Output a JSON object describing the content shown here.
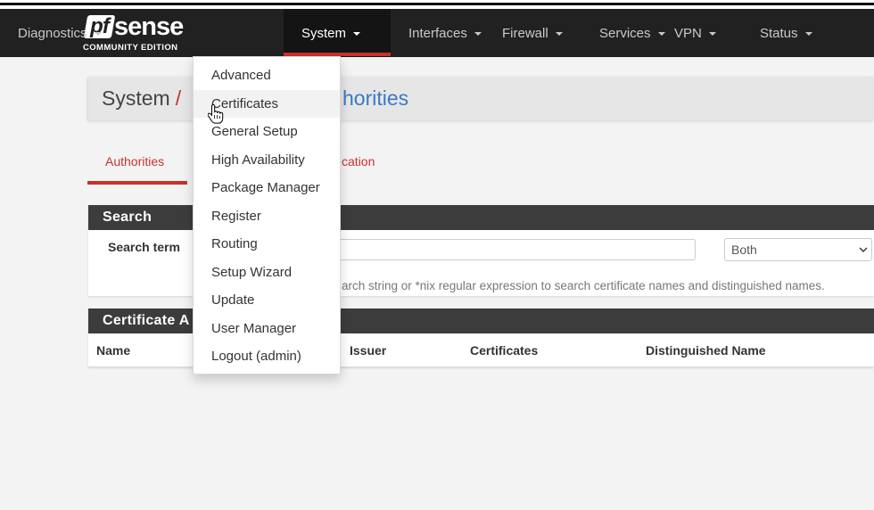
{
  "logo": {
    "mark": "pf",
    "wordmark": "sense",
    "edition": "COMMUNITY EDITION"
  },
  "navbar": {
    "items": [
      {
        "label": "System",
        "active": true,
        "icon": "caret-down-icon"
      },
      {
        "label": "Interfaces",
        "active": false,
        "icon": "caret-down-icon"
      },
      {
        "label": "Firewall",
        "active": false,
        "icon": "caret-down-icon"
      },
      {
        "label": "Services",
        "active": false,
        "icon": "caret-down-icon"
      },
      {
        "label": "VPN",
        "active": false,
        "icon": "caret-down-icon"
      },
      {
        "label": "Status",
        "active": false,
        "icon": "caret-down-icon"
      },
      {
        "label": "Diagnostics",
        "active": false,
        "icon": "caret-down-icon"
      }
    ]
  },
  "system_menu": {
    "open": true,
    "hovered_index": 1,
    "items": [
      "Advanced",
      "Certificates",
      "General Setup",
      "High Availability",
      "Package Manager",
      "Register",
      "Routing",
      "Setup Wizard",
      "Update",
      "User Manager",
      "Logout (admin)"
    ]
  },
  "cursor": {
    "icon": "pointer-hand-icon"
  },
  "breadcrumb": {
    "root": "System",
    "separator": "/",
    "current_visible_text": "horities"
  },
  "tabs": [
    {
      "label": "Authorities",
      "active": true
    },
    {
      "label": "cation",
      "active": false
    }
  ],
  "search_panel": {
    "title": "Search",
    "term_label": "Search term",
    "scope_select": {
      "selected": "Both",
      "icon": "chevron-down-icon"
    },
    "help_text": "arch string or *nix regular expression to search certificate names and distinguished names."
  },
  "ca_panel": {
    "title": "Certificate A",
    "columns": [
      "Name",
      "Issuer",
      "Certificates",
      "Distinguished Name"
    ]
  },
  "colors": {
    "page_bg": "#f3f3f3",
    "navbar_bg": "#212121",
    "navbar_active_bg": "#141414",
    "accent_red": "#c8322d",
    "link_blue": "#3a7ac2",
    "panel_header_bg": "#3c3c3c",
    "breadcrumb_bg": "#e6e6e6"
  }
}
